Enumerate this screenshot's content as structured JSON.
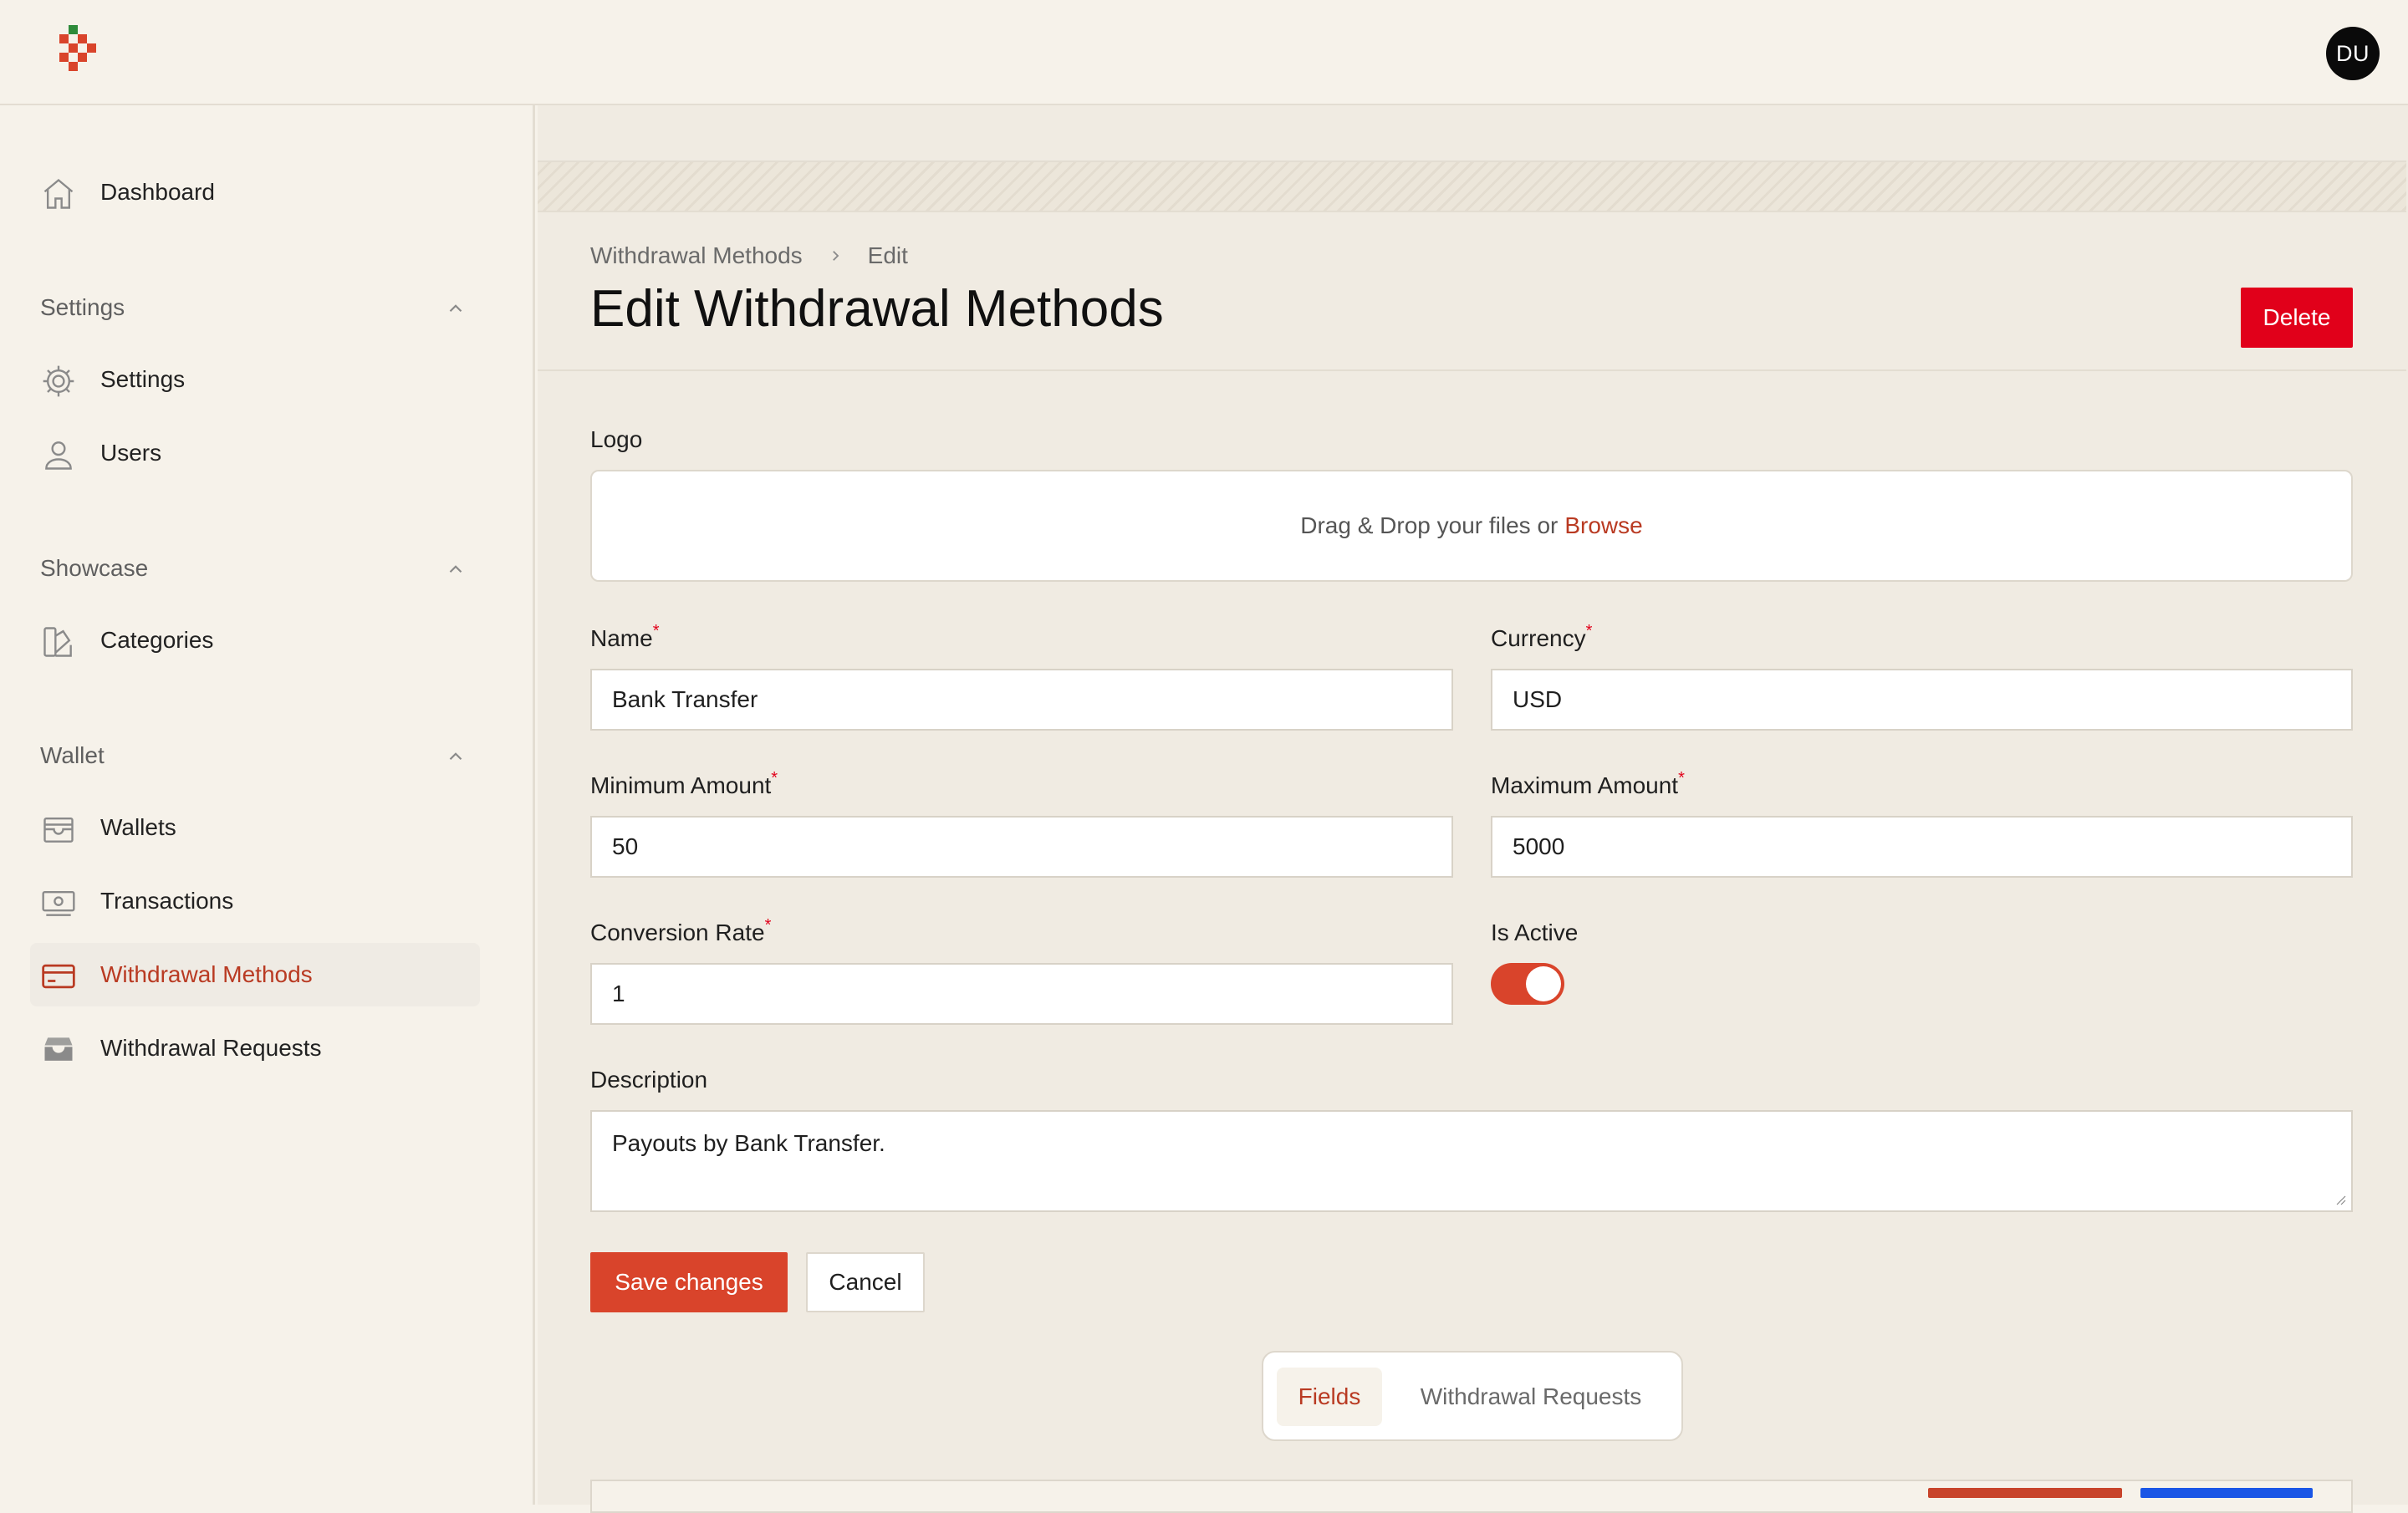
{
  "header": {
    "avatar_initials": "DU"
  },
  "sidebar": {
    "dashboard": "Dashboard",
    "groups": [
      {
        "title": "Settings",
        "items": [
          "Settings",
          "Users"
        ]
      },
      {
        "title": "Showcase",
        "items": [
          "Categories"
        ]
      },
      {
        "title": "Wallet",
        "items": [
          "Wallets",
          "Transactions",
          "Withdrawal Methods",
          "Withdrawal Requests"
        ]
      }
    ],
    "active_item": "Withdrawal Methods"
  },
  "breadcrumb": [
    "Withdrawal Methods",
    "Edit"
  ],
  "page_title": "Edit Withdrawal Methods",
  "delete_label": "Delete",
  "form": {
    "logo_label": "Logo",
    "drop_text": "Drag & Drop your files or",
    "browse_text": "Browse",
    "name_label": "Name",
    "name_value": "Bank Transfer",
    "currency_label": "Currency",
    "currency_value": "USD",
    "min_label": "Minimum Amount",
    "min_value": "50",
    "max_label": "Maximum Amount",
    "max_value": "5000",
    "rate_label": "Conversion Rate",
    "rate_value": "1",
    "active_label": "Is Active",
    "active_value": true,
    "description_label": "Description",
    "description_value": "Payouts by Bank Transfer.",
    "required_mark": "*",
    "save_label": "Save changes",
    "cancel_label": "Cancel"
  },
  "tabs": [
    "Fields",
    "Withdrawal Requests"
  ],
  "colors": {
    "accent": "#d9442b",
    "danger": "#e1001a",
    "active_text": "#b93a22"
  }
}
